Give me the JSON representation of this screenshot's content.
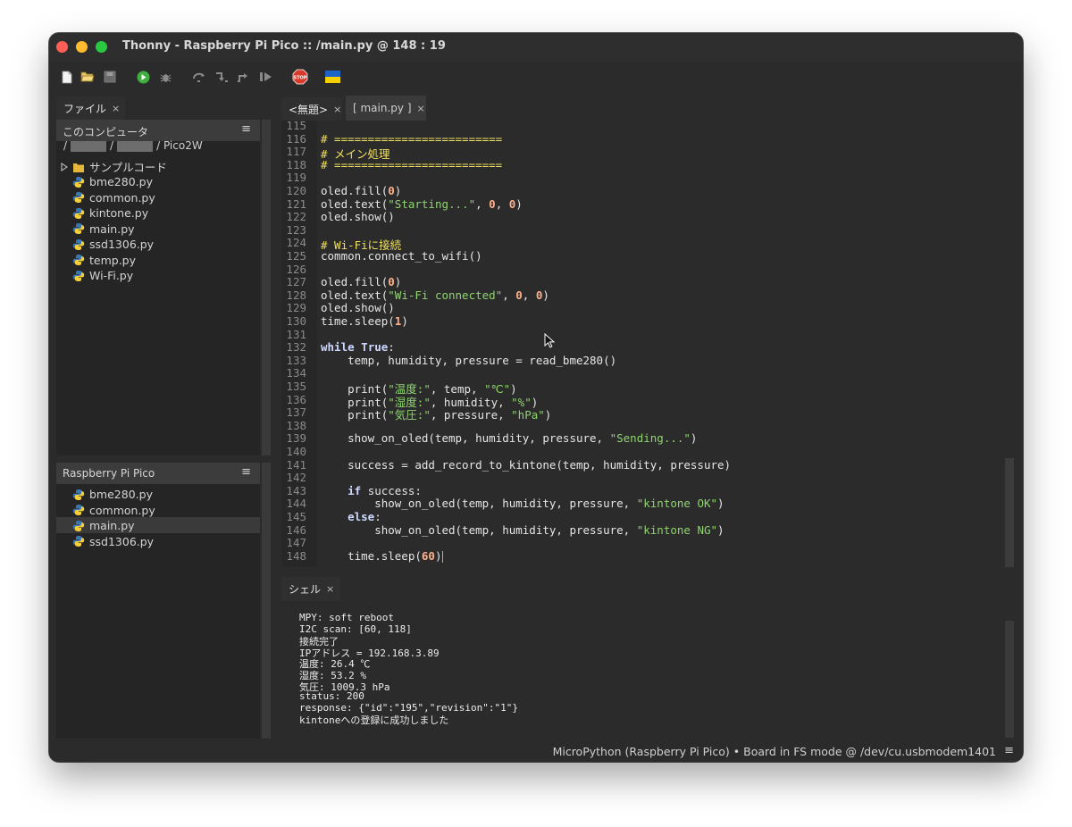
{
  "window": {
    "title": "Thonny  -  Raspberry Pi Pico :: /main.py  @  148 : 19"
  },
  "toolbar": {
    "icons": [
      "new-file-icon",
      "open-file-icon",
      "save-icon",
      "run-icon",
      "debug-icon",
      "step-over-icon",
      "step-into-icon",
      "step-out-icon",
      "resume-icon",
      "stop-icon",
      "ukraine-flag-icon"
    ],
    "stop_label": "STOP"
  },
  "files_panel": {
    "tab_label": "ファイル",
    "tab_close": "×",
    "local_title": "このコンピュータ",
    "local_path_prefix": "/",
    "local_path_sep": "/",
    "local_path_suffix": "/ Pico2W",
    "menu_glyph": "≡",
    "local_items": [
      {
        "name": "サンプルコード",
        "type": "folder"
      },
      {
        "name": "bme280.py",
        "type": "python"
      },
      {
        "name": "common.py",
        "type": "python"
      },
      {
        "name": "kintone.py",
        "type": "python"
      },
      {
        "name": "main.py",
        "type": "python"
      },
      {
        "name": "ssd1306.py",
        "type": "python"
      },
      {
        "name": "temp.py",
        "type": "python"
      },
      {
        "name": "Wi-Fi.py",
        "type": "python"
      }
    ],
    "device_title": "Raspberry Pi Pico",
    "device_items": [
      {
        "name": "bme280.py",
        "selected": false
      },
      {
        "name": "common.py",
        "selected": false
      },
      {
        "name": "main.py",
        "selected": true
      },
      {
        "name": "ssd1306.py",
        "selected": false
      }
    ]
  },
  "editor": {
    "tabs": [
      {
        "label": "<無題>",
        "close": "×",
        "active": true
      },
      {
        "label": "[ main.py ]",
        "close": "×",
        "active": false
      }
    ],
    "lines": [
      {
        "n": "115",
        "code": ""
      },
      {
        "n": "116",
        "code": "# ========================="
      },
      {
        "n": "117",
        "code": "# メイン処理"
      },
      {
        "n": "118",
        "code": "# ========================="
      },
      {
        "n": "119",
        "code": ""
      },
      {
        "n": "120",
        "code": "oled.fill(0)"
      },
      {
        "n": "121",
        "code": "oled.text(\"Starting...\", 0, 0)"
      },
      {
        "n": "122",
        "code": "oled.show()"
      },
      {
        "n": "123",
        "code": ""
      },
      {
        "n": "124",
        "code": "# Wi-Fiに接続"
      },
      {
        "n": "125",
        "code": "common.connect_to_wifi()"
      },
      {
        "n": "126",
        "code": ""
      },
      {
        "n": "127",
        "code": "oled.fill(0)"
      },
      {
        "n": "128",
        "code": "oled.text(\"Wi-Fi connected\", 0, 0)"
      },
      {
        "n": "129",
        "code": "oled.show()"
      },
      {
        "n": "130",
        "code": "time.sleep(1)"
      },
      {
        "n": "131",
        "code": ""
      },
      {
        "n": "132",
        "code": "while True:"
      },
      {
        "n": "133",
        "code": "    temp, humidity, pressure = read_bme280()"
      },
      {
        "n": "134",
        "code": ""
      },
      {
        "n": "135",
        "code": "    print(\"温度:\", temp, \"℃\")"
      },
      {
        "n": "136",
        "code": "    print(\"湿度:\", humidity, \"%\")"
      },
      {
        "n": "137",
        "code": "    print(\"気圧:\", pressure, \"hPa\")"
      },
      {
        "n": "138",
        "code": ""
      },
      {
        "n": "139",
        "code": "    show_on_oled(temp, humidity, pressure, \"Sending...\")"
      },
      {
        "n": "140",
        "code": ""
      },
      {
        "n": "141",
        "code": "    success = add_record_to_kintone(temp, humidity, pressure)"
      },
      {
        "n": "142",
        "code": ""
      },
      {
        "n": "143",
        "code": "    if success:"
      },
      {
        "n": "144",
        "code": "        show_on_oled(temp, humidity, pressure, \"kintone OK\")"
      },
      {
        "n": "145",
        "code": "    else:"
      },
      {
        "n": "146",
        "code": "        show_on_oled(temp, humidity, pressure, \"kintone NG\")"
      },
      {
        "n": "147",
        "code": ""
      },
      {
        "n": "148",
        "code": "    time.sleep(60)"
      }
    ]
  },
  "shell": {
    "tab_label": "シェル",
    "tab_close": "×",
    "lines": [
      "MPY: soft reboot",
      "I2C scan: [60, 118]",
      "接続完了",
      "IPアドレス = 192.168.3.89",
      "温度: 26.4 ℃",
      "湿度: 53.2 %",
      "気圧: 1009.3 hPa",
      "status: 200",
      "response: {\"id\":\"195\",\"revision\":\"1\"}",
      "kintoneへの登録に成功しました"
    ]
  },
  "status": {
    "text": "MicroPython (Raspberry Pi Pico)  •  Board in FS mode @ /dev/cu.usbmodem1401",
    "menu_glyph": "≡"
  },
  "colors": {
    "comment": "#f0e060",
    "keyword": "#cdd8ff",
    "string": "#8fd46f",
    "number": "#ffb08a"
  }
}
